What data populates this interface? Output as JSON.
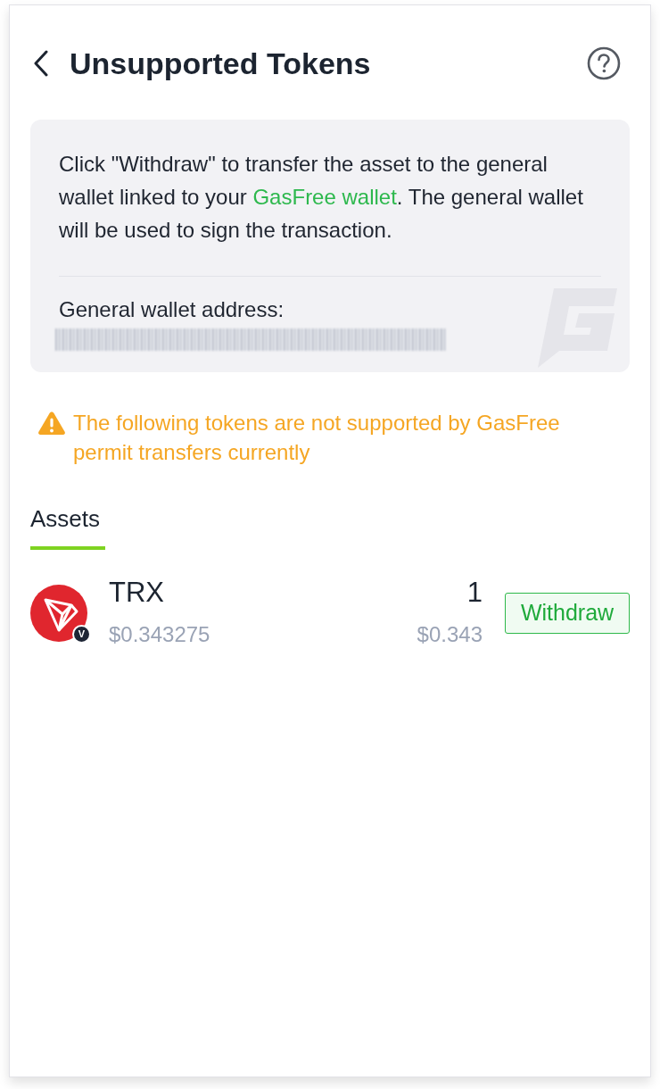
{
  "header": {
    "title": "Unsupported Tokens"
  },
  "info_card": {
    "text_before": "Click \"Withdraw\" to transfer the asset to the general wallet linked to your ",
    "link": "GasFree wallet",
    "text_after": ". The general wallet will be used to sign the transaction.",
    "address_label": "General wallet address:"
  },
  "warning": {
    "text": "The following tokens are not supported by GasFree permit transfers currently"
  },
  "tabs": [
    {
      "label": "Assets",
      "selected": true
    }
  ],
  "assets": [
    {
      "symbol": "TRX",
      "price": "$0.343275",
      "amount": "1",
      "value": "$0.343",
      "badge": "V",
      "action": "Withdraw"
    }
  ]
}
